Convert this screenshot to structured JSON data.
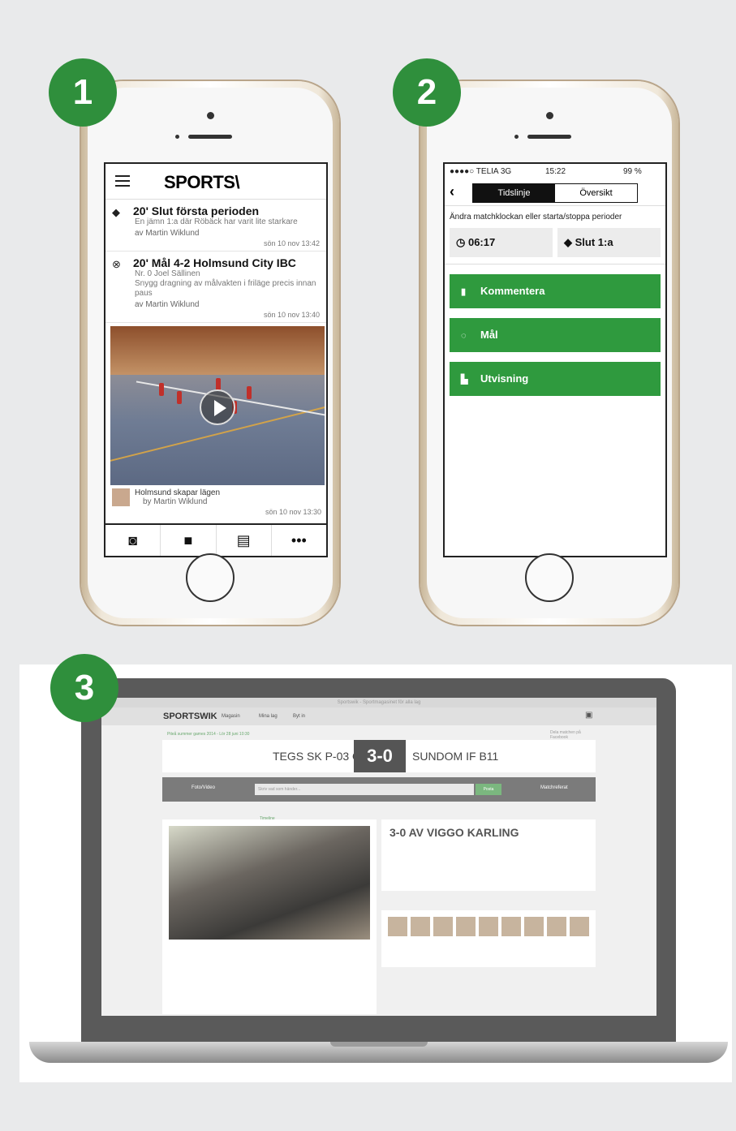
{
  "badges": [
    "1",
    "2",
    "3"
  ],
  "phone1": {
    "logo": "SPORTS\\",
    "feed": [
      {
        "icon": "whistle-icon",
        "title": "20' Slut första perioden",
        "subtitle": "En jämn 1:a där Röbäck har varit lite starkare",
        "author": "av Martin Wiklund",
        "date": "sön 10 nov 13:42"
      },
      {
        "icon": "ball-icon",
        "title": "20' Mål 4-2 Holmsund City IBC",
        "subtitle": "Nr. 0 Joel Sällinen\nSnygg dragning av målvakten i friläge precis innan paus",
        "author": "av Martin Wiklund",
        "date": "sön 10 nov 13:40"
      }
    ],
    "video": {
      "caption": "Holmsund skapar lägen",
      "author": "by Martin Wiklund",
      "date": "sön 10 nov 13:30"
    },
    "tabs": [
      {
        "name": "camera-icon",
        "glyph": "◙"
      },
      {
        "name": "video-icon",
        "glyph": "■"
      },
      {
        "name": "comment-icon",
        "glyph": "▤"
      },
      {
        "name": "more-icon",
        "glyph": "•••"
      }
    ]
  },
  "phone2": {
    "status": {
      "carrier": "●●●●○ TELIA  3G",
      "time": "15:22",
      "battery": "99 %"
    },
    "segments": [
      "Tidslinje",
      "Översikt"
    ],
    "hint": "Ändra matchklockan eller starta/stoppa perioder",
    "clock": "06:17",
    "period": "Slut 1:a",
    "buttons": [
      {
        "label": "Kommentera",
        "icon": "comment-icon",
        "glyph": "▮"
      },
      {
        "label": "Mål",
        "icon": "ball-icon",
        "glyph": "◌"
      },
      {
        "label": "Utvisning",
        "icon": "penalty-icon",
        "glyph": "▙"
      }
    ]
  },
  "laptop": {
    "title": "Sportswik - Sportmagasinet för alla lag",
    "logo": "SPORTSWIK",
    "nav": [
      "Magasin",
      "Mina lag",
      "Byt in"
    ],
    "headline": "Piteå summer games 2014 - Lör 28 juni 10:30",
    "home": "TEGS SK P-03 ÖST",
    "score": "3-0",
    "away": "SUNDOM IF B11",
    "bar": {
      "left": "Foto/Video",
      "placeholder": "Skriv vad som händer...",
      "publish": "Posta",
      "right": "Matchreferat"
    },
    "card_title": "3-0 AV VIGGO KARLING",
    "timeline_label": "Timeline",
    "facebook": "Dela matchen på Facebook"
  }
}
